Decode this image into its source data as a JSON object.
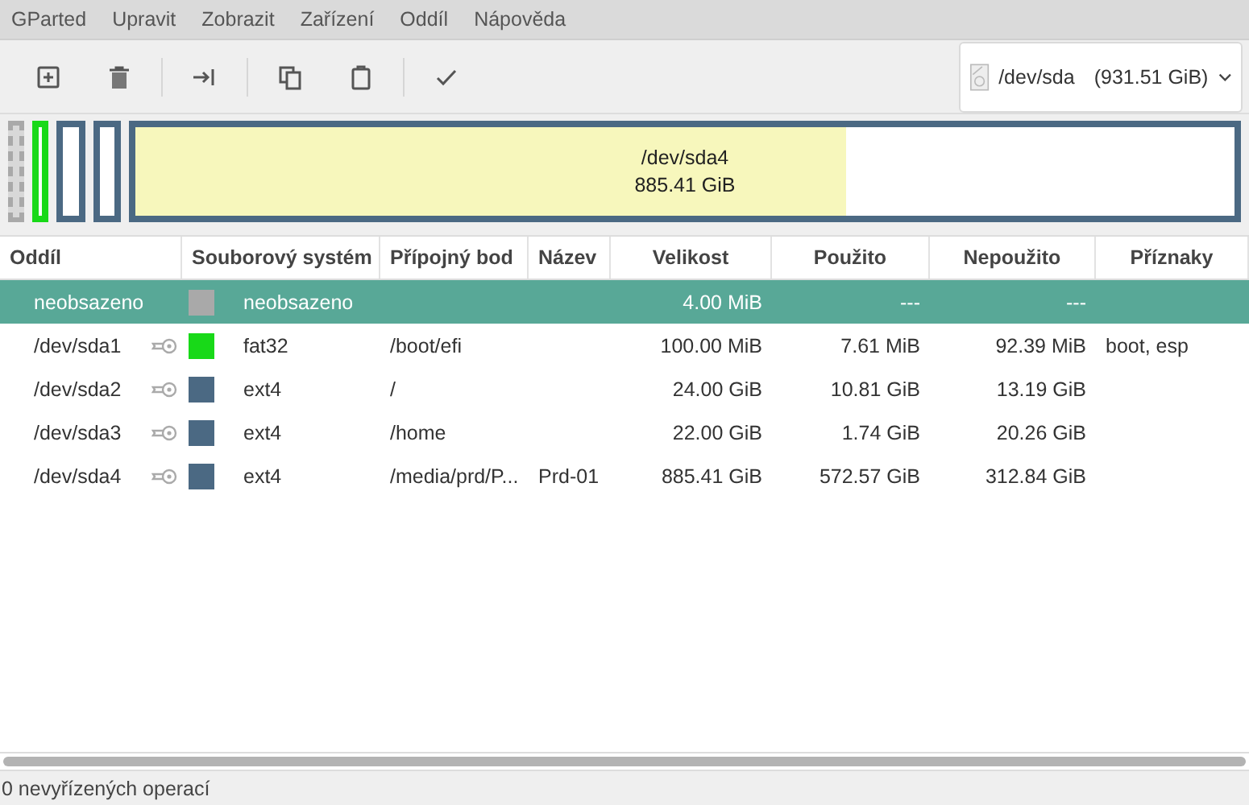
{
  "menu": [
    "GParted",
    "Upravit",
    "Zobrazit",
    "Zařízení",
    "Oddíl",
    "Nápověda"
  ],
  "toolbar": [
    {
      "kind": "new",
      "disabled": false
    },
    {
      "kind": "delete",
      "disabled": false
    },
    {
      "kind": "sep"
    },
    {
      "kind": "resize",
      "disabled": false
    },
    {
      "kind": "sep"
    },
    {
      "kind": "copy",
      "disabled": false
    },
    {
      "kind": "paste",
      "disabled": false
    },
    {
      "kind": "sep"
    },
    {
      "kind": "apply",
      "disabled": false
    }
  ],
  "device": {
    "name": "/dev/sda",
    "size": "(931.51 GiB)"
  },
  "disk_map": [
    {
      "kind": "unallocated",
      "color": "#a9a9a9"
    },
    {
      "kind": "partition",
      "color": "#18d918"
    },
    {
      "kind": "partition",
      "color": "#4b6983"
    },
    {
      "kind": "partition",
      "color": "#4b6983"
    },
    {
      "kind": "partition",
      "color": "#4b6983",
      "level": 0.647,
      "name": "/dev/sda4",
      "size": "885.41 GiB"
    }
  ],
  "table": {
    "columns": [
      "Oddíl",
      "Souborový systém",
      "Přípojný bod",
      "Název",
      "Velikost",
      "Použito",
      "Nepoužito",
      "Příznaky"
    ],
    "rows": [
      {
        "selected": true,
        "partition": "neobsazeno",
        "mounted": false,
        "color": "#a9a9a9",
        "filesystem": "neobsazeno",
        "mount_point": "",
        "label": "",
        "size": "4.00 MiB",
        "used": "---",
        "unused": "---",
        "flags": ""
      },
      {
        "selected": false,
        "partition": "/dev/sda1",
        "mounted": true,
        "color": "#18d918",
        "filesystem": "fat32",
        "mount_point": "/boot/efi",
        "label": "",
        "size": "100.00 MiB",
        "used": "7.61 MiB",
        "unused": "92.39 MiB",
        "flags": "boot, esp"
      },
      {
        "selected": false,
        "partition": "/dev/sda2",
        "mounted": true,
        "color": "#4b6983",
        "filesystem": "ext4",
        "mount_point": "/",
        "label": "",
        "size": "24.00 GiB",
        "used": "10.81 GiB",
        "unused": "13.19 GiB",
        "flags": ""
      },
      {
        "selected": false,
        "partition": "/dev/sda3",
        "mounted": true,
        "color": "#4b6983",
        "filesystem": "ext4",
        "mount_point": "/home",
        "label": "",
        "size": "22.00 GiB",
        "used": "1.74 GiB",
        "unused": "20.26 GiB",
        "flags": ""
      },
      {
        "selected": false,
        "partition": "/dev/sda4",
        "mounted": true,
        "color": "#4b6983",
        "filesystem": "ext4",
        "mount_point": "/media/prd/P...",
        "label": "Prd-01",
        "size": "885.41 GiB",
        "used": "572.57 GiB",
        "unused": "312.84 GiB",
        "flags": ""
      }
    ]
  },
  "status_bar": "0 nevyřízených operací"
}
